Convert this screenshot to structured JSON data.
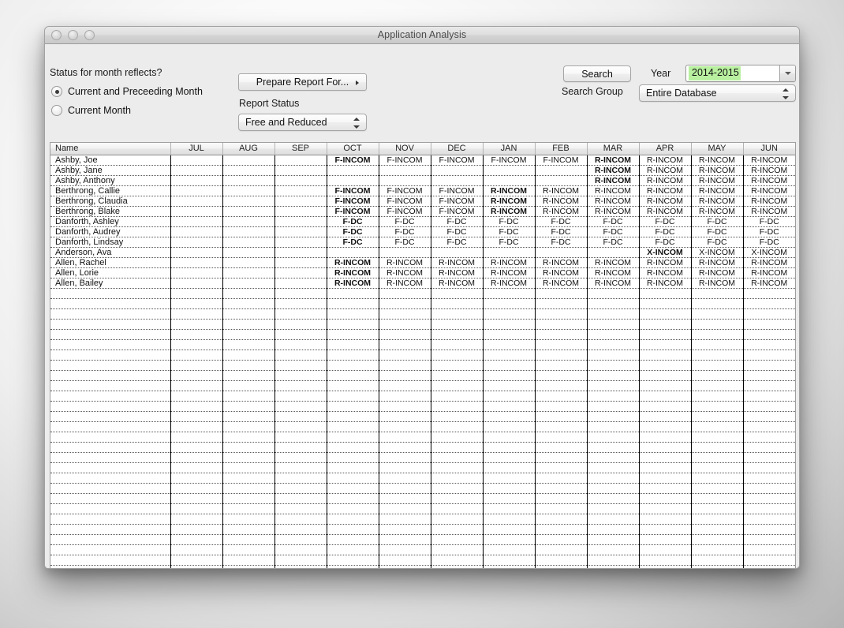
{
  "window": {
    "title": "Application Analysis",
    "traffic_lights": [
      "close-button",
      "minimize-button",
      "zoom-button"
    ]
  },
  "controls": {
    "status_question": "Status for month reflects?",
    "radio_options": [
      {
        "label": "Current and Preceeding Month",
        "selected": true
      },
      {
        "label": "Current Month",
        "selected": false
      }
    ],
    "prepare_report_button": "Prepare Report For...",
    "report_status_label": "Report Status",
    "report_status_value": "Free and Reduced",
    "search_button": "Search",
    "year_label": "Year",
    "year_value": "2014-2015",
    "year_highlight_color": "#b9f0a0",
    "search_group_label": "Search Group",
    "search_group_value": "Entire Database"
  },
  "table": {
    "columns": [
      "Name",
      "JUL",
      "AUG",
      "SEP",
      "OCT",
      "NOV",
      "DEC",
      "JAN",
      "FEB",
      "MAR",
      "APR",
      "MAY",
      "JUN"
    ],
    "total_visible_rows": 45,
    "rows": [
      {
        "name": "Ashby, Joe",
        "cells": [
          "",
          "",
          "",
          "F-INCOM",
          "F-INCOM",
          "F-INCOM",
          "F-INCOM",
          "F-INCOM",
          "R-INCOM",
          "R-INCOM",
          "R-INCOM",
          "R-INCOM"
        ],
        "bold": [
          false,
          false,
          false,
          true,
          false,
          false,
          false,
          false,
          true,
          false,
          false,
          false
        ]
      },
      {
        "name": "Ashby, Jane",
        "cells": [
          "",
          "",
          "",
          "",
          "",
          "",
          "",
          "",
          "R-INCOM",
          "R-INCOM",
          "R-INCOM",
          "R-INCOM"
        ],
        "bold": [
          false,
          false,
          false,
          false,
          false,
          false,
          false,
          false,
          true,
          false,
          false,
          false
        ]
      },
      {
        "name": "Ashby, Anthony",
        "cells": [
          "",
          "",
          "",
          "",
          "",
          "",
          "",
          "",
          "R-INCOM",
          "R-INCOM",
          "R-INCOM",
          "R-INCOM"
        ],
        "bold": [
          false,
          false,
          false,
          false,
          false,
          false,
          false,
          false,
          true,
          false,
          false,
          false
        ]
      },
      {
        "name": "Berthrong, Callie",
        "cells": [
          "",
          "",
          "",
          "F-INCOM",
          "F-INCOM",
          "F-INCOM",
          "R-INCOM",
          "R-INCOM",
          "R-INCOM",
          "R-INCOM",
          "R-INCOM",
          "R-INCOM"
        ],
        "bold": [
          false,
          false,
          false,
          true,
          false,
          false,
          true,
          false,
          false,
          false,
          false,
          false
        ]
      },
      {
        "name": "Berthrong, Claudia",
        "cells": [
          "",
          "",
          "",
          "F-INCOM",
          "F-INCOM",
          "F-INCOM",
          "R-INCOM",
          "R-INCOM",
          "R-INCOM",
          "R-INCOM",
          "R-INCOM",
          "R-INCOM"
        ],
        "bold": [
          false,
          false,
          false,
          true,
          false,
          false,
          true,
          false,
          false,
          false,
          false,
          false
        ]
      },
      {
        "name": "Berthrong, Blake",
        "cells": [
          "",
          "",
          "",
          "F-INCOM",
          "F-INCOM",
          "F-INCOM",
          "R-INCOM",
          "R-INCOM",
          "R-INCOM",
          "R-INCOM",
          "R-INCOM",
          "R-INCOM"
        ],
        "bold": [
          false,
          false,
          false,
          true,
          false,
          false,
          true,
          false,
          false,
          false,
          false,
          false
        ]
      },
      {
        "name": "Danforth, Ashley",
        "cells": [
          "",
          "",
          "",
          "F-DC",
          "F-DC",
          "F-DC",
          "F-DC",
          "F-DC",
          "F-DC",
          "F-DC",
          "F-DC",
          "F-DC"
        ],
        "bold": [
          false,
          false,
          false,
          true,
          false,
          false,
          false,
          false,
          false,
          false,
          false,
          false
        ]
      },
      {
        "name": "Danforth, Audrey",
        "cells": [
          "",
          "",
          "",
          "F-DC",
          "F-DC",
          "F-DC",
          "F-DC",
          "F-DC",
          "F-DC",
          "F-DC",
          "F-DC",
          "F-DC"
        ],
        "bold": [
          false,
          false,
          false,
          true,
          false,
          false,
          false,
          false,
          false,
          false,
          false,
          false
        ]
      },
      {
        "name": "Danforth, Lindsay",
        "cells": [
          "",
          "",
          "",
          "F-DC",
          "F-DC",
          "F-DC",
          "F-DC",
          "F-DC",
          "F-DC",
          "F-DC",
          "F-DC",
          "F-DC"
        ],
        "bold": [
          false,
          false,
          false,
          true,
          false,
          false,
          false,
          false,
          false,
          false,
          false,
          false
        ]
      },
      {
        "name": "Anderson, Ava",
        "cells": [
          "",
          "",
          "",
          "",
          "",
          "",
          "",
          "",
          "",
          "X-INCOM",
          "X-INCOM",
          "X-INCOM"
        ],
        "bold": [
          false,
          false,
          false,
          false,
          false,
          false,
          false,
          false,
          false,
          true,
          false,
          false
        ]
      },
      {
        "name": "Allen, Rachel",
        "cells": [
          "",
          "",
          "",
          "R-INCOM",
          "R-INCOM",
          "R-INCOM",
          "R-INCOM",
          "R-INCOM",
          "R-INCOM",
          "R-INCOM",
          "R-INCOM",
          "R-INCOM"
        ],
        "bold": [
          false,
          false,
          false,
          true,
          false,
          false,
          false,
          false,
          false,
          false,
          false,
          false
        ]
      },
      {
        "name": "Allen, Lorie",
        "cells": [
          "",
          "",
          "",
          "R-INCOM",
          "R-INCOM",
          "R-INCOM",
          "R-INCOM",
          "R-INCOM",
          "R-INCOM",
          "R-INCOM",
          "R-INCOM",
          "R-INCOM"
        ],
        "bold": [
          false,
          false,
          false,
          true,
          false,
          false,
          false,
          false,
          false,
          false,
          false,
          false
        ]
      },
      {
        "name": "Allen, Bailey",
        "cells": [
          "",
          "",
          "",
          "R-INCOM",
          "R-INCOM",
          "R-INCOM",
          "R-INCOM",
          "R-INCOM",
          "R-INCOM",
          "R-INCOM",
          "R-INCOM",
          "R-INCOM"
        ],
        "bold": [
          false,
          false,
          false,
          true,
          false,
          false,
          false,
          false,
          false,
          false,
          false,
          false
        ]
      }
    ]
  }
}
